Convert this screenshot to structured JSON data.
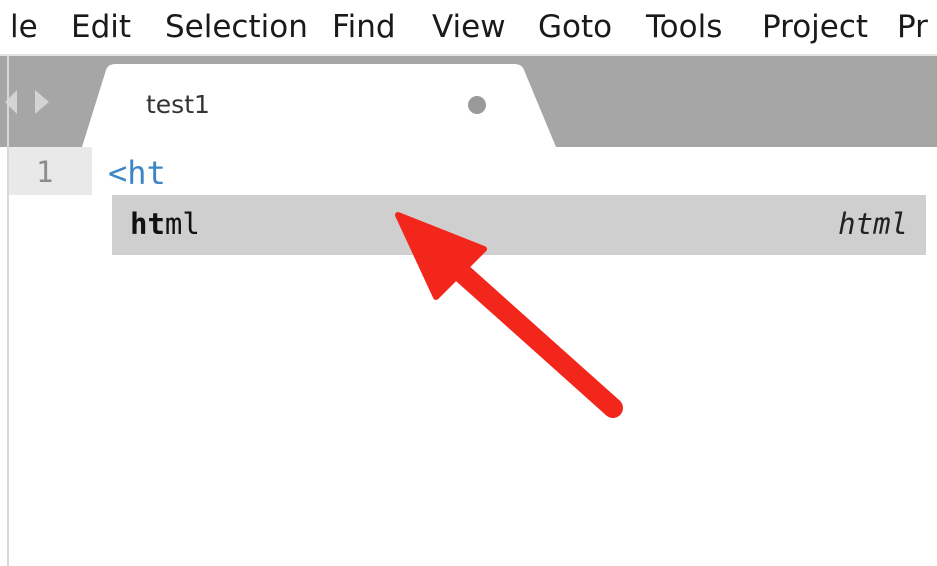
{
  "menu": {
    "items": [
      "le",
      "Edit",
      "Selection",
      "Find",
      "View",
      "Goto",
      "Tools",
      "Project",
      "Pr"
    ]
  },
  "tab": {
    "title": "test1",
    "has_unsaved_changes": true
  },
  "editor": {
    "line_number": "1",
    "code": "<ht",
    "syntax_color": "#3d86c6"
  },
  "autocomplete": {
    "trigger_matched": "ht",
    "trigger_rest": "ml",
    "hint": "html"
  },
  "annotation": {
    "type": "arrow",
    "color": "#f2261b",
    "direction": "pointing up-left at autocomplete suggestion"
  },
  "colors": {
    "tabbar": "#a6a6a6",
    "tab": "#ffffff",
    "gutter": "#e9e9e9",
    "popup": "#cfcfcf"
  }
}
